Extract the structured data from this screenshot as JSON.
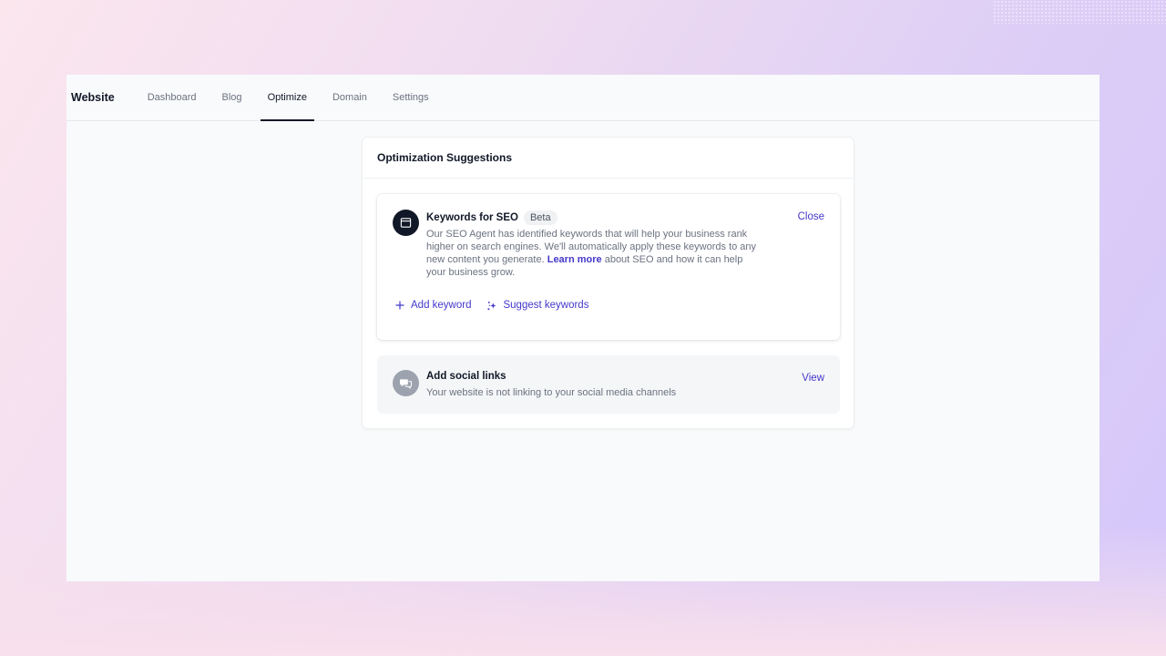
{
  "nav": {
    "brand": "Website",
    "tabs": [
      {
        "label": "Dashboard",
        "active": false
      },
      {
        "label": "Blog",
        "active": false
      },
      {
        "label": "Optimize",
        "active": true
      },
      {
        "label": "Domain",
        "active": false
      },
      {
        "label": "Settings",
        "active": false
      }
    ]
  },
  "panel": {
    "title": "Optimization Suggestions",
    "seo_card": {
      "icon": "browser-window-icon",
      "title": "Keywords for SEO",
      "badge": "Beta",
      "action": "Close",
      "desc_before": "Our SEO Agent has identified keywords that will help your business rank higher on search engines. We'll automatically apply these keywords to any new content you generate.",
      "learn_more": "Learn more",
      "desc_after": "about SEO and how it can help your business grow.",
      "add_keyword": "Add keyword",
      "suggest_keywords": "Suggest keywords"
    },
    "social_card": {
      "icon": "speech-bubbles-icon",
      "title": "Add social links",
      "desc": "Your website is not linking to your social media channels",
      "action": "View"
    }
  },
  "colors": {
    "accent": "#4338ca",
    "text": "#111827",
    "muted": "#6b7280"
  }
}
